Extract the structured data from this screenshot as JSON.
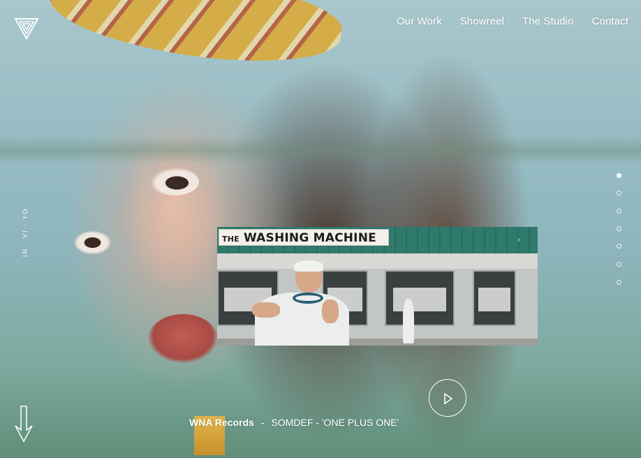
{
  "nav": {
    "items": [
      {
        "label": "Our Work"
      },
      {
        "label": "Showreel"
      },
      {
        "label": "The Studio"
      },
      {
        "label": "Contact"
      }
    ]
  },
  "side_text": "IN · VI · YO",
  "slides": {
    "count": 7,
    "active_index": 0
  },
  "video": {
    "sign_text": "THE WASHING MACHINE",
    "sign_prefix": "THE",
    "sign_main": "WASHING MACHINE"
  },
  "caption": {
    "label": "WNA Records",
    "separator": "-",
    "title": "SOMDEF - 'ONE PLUS ONE'"
  },
  "icons": {
    "logo": "triangle-logo-icon",
    "play": "play-icon",
    "scroll": "arrow-down-icon"
  },
  "colors": {
    "text": "#ffffff",
    "awning": "#2f7a6d"
  }
}
